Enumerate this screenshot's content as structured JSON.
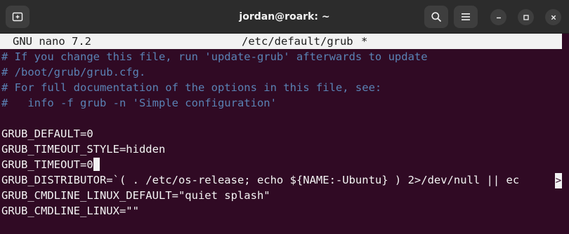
{
  "window": {
    "title": "jordan@roark: ~"
  },
  "icons": {
    "new_tab": "new-tab-icon",
    "search": "search-icon",
    "menu": "hamburger-menu-icon",
    "minimize": "minimize-icon",
    "maximize": "maximize-icon",
    "close": "close-icon"
  },
  "nano": {
    "version": "GNU nano 7.2",
    "filename": "/etc/default/grub",
    "modified": "*"
  },
  "lines": {
    "c1": "# If you change this file, run 'update-grub' afterwards to update",
    "c2": "# /boot/grub/grub.cfg.",
    "c3": "# For full documentation of the options in this file, see:",
    "c4": "#   info -f grub -n 'Simple configuration'",
    "l1": "GRUB_DEFAULT=0",
    "l2": "GRUB_TIMEOUT_STYLE=hidden",
    "l3": "GRUB_TIMEOUT=0",
    "l4": "GRUB_DISTRIBUTOR=`( . /etc/os-release; echo ${NAME:-Ubuntu} ) 2>/dev/null || ec",
    "l5": "GRUB_CMDLINE_LINUX_DEFAULT=\"quiet splash\"",
    "l6": "GRUB_CMDLINE_LINUX=\"\""
  },
  "overflow_marker": ">",
  "colors": {
    "terminal_bg": "#300a24",
    "comment": "#5a82b4",
    "text": "#f4f4f4",
    "titlebar": "#2c2c2c"
  }
}
